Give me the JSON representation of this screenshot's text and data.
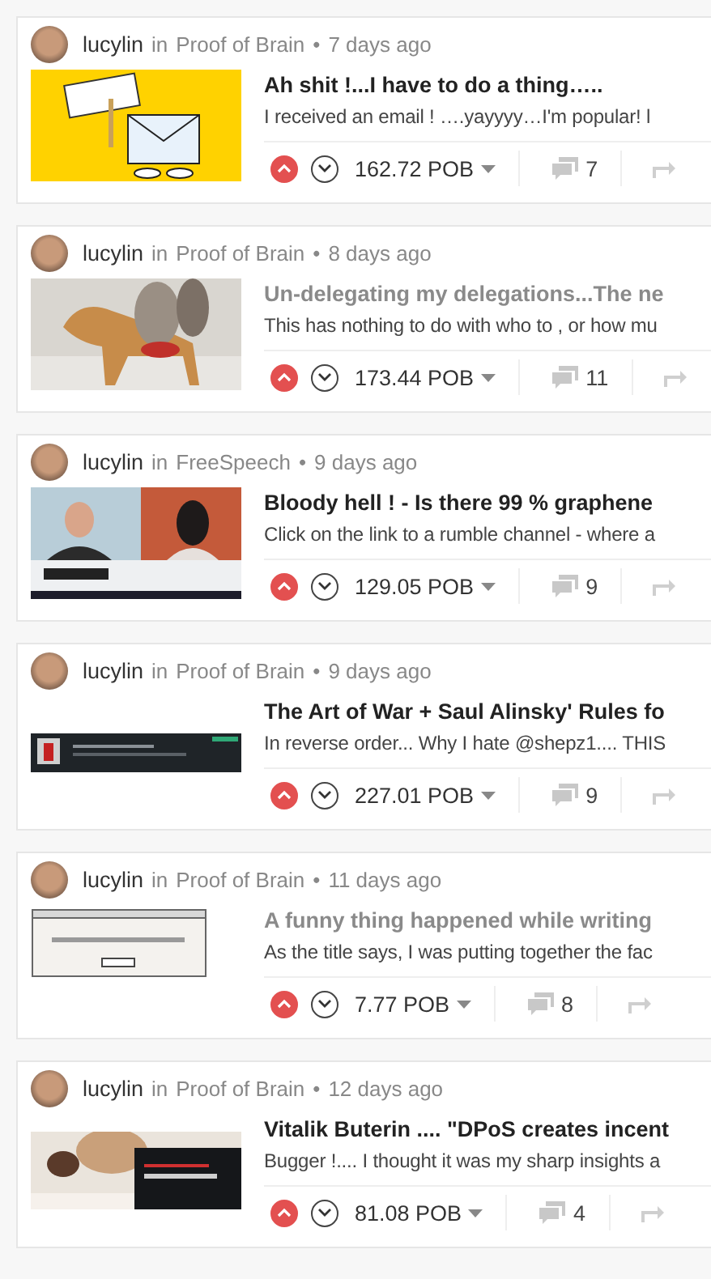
{
  "posts": [
    {
      "author": "lucylin",
      "preposition": "in",
      "community": "Proof of Brain",
      "separator": "•",
      "age": "7 days ago",
      "title": "Ah shit !...I have to do a thing…..",
      "visited": false,
      "excerpt": "I received an email ! ….yayyyy…I'm popular! l",
      "upvoted": true,
      "downvoted": false,
      "payout": "162.72 POB",
      "comments": "7"
    },
    {
      "author": "lucylin",
      "preposition": "in",
      "community": "Proof of Brain",
      "separator": "•",
      "age": "8 days ago",
      "title": "Un-delegating my delegations...The ne",
      "visited": true,
      "excerpt": "This has nothing to do with who to , or how mu",
      "upvoted": true,
      "downvoted": false,
      "payout": "173.44 POB",
      "comments": "11"
    },
    {
      "author": "lucylin",
      "preposition": "in",
      "community": "FreeSpeech",
      "separator": "•",
      "age": "9 days ago",
      "title": "Bloody hell ! - Is there 99 % graphene",
      "visited": false,
      "excerpt": "Click on the link to a rumble channel - where a",
      "upvoted": true,
      "downvoted": false,
      "payout": "129.05 POB",
      "comments": "9"
    },
    {
      "author": "lucylin",
      "preposition": "in",
      "community": "Proof of Brain",
      "separator": "•",
      "age": "9 days ago",
      "title": "The Art of War + Saul Alinsky' Rules fo",
      "visited": false,
      "excerpt": "In reverse order... Why I hate @shepz1.... THIS",
      "upvoted": true,
      "downvoted": false,
      "payout": "227.01 POB",
      "comments": "9"
    },
    {
      "author": "lucylin",
      "preposition": "in",
      "community": "Proof of Brain",
      "separator": "•",
      "age": "11 days ago",
      "title": "A funny thing happened while writing",
      "visited": true,
      "excerpt": "As the title says, I was putting together the fac",
      "upvoted": true,
      "downvoted": false,
      "payout": "7.77 POB",
      "comments": "8"
    },
    {
      "author": "lucylin",
      "preposition": "in",
      "community": "Proof of Brain",
      "separator": "•",
      "age": "12 days ago",
      "title": "Vitalik Buterin .... \"DPoS creates incent",
      "visited": false,
      "excerpt": "Bugger !.... I thought it was my sharp insights a",
      "upvoted": true,
      "downvoted": false,
      "payout": "81.08 POB",
      "comments": "4"
    }
  ]
}
